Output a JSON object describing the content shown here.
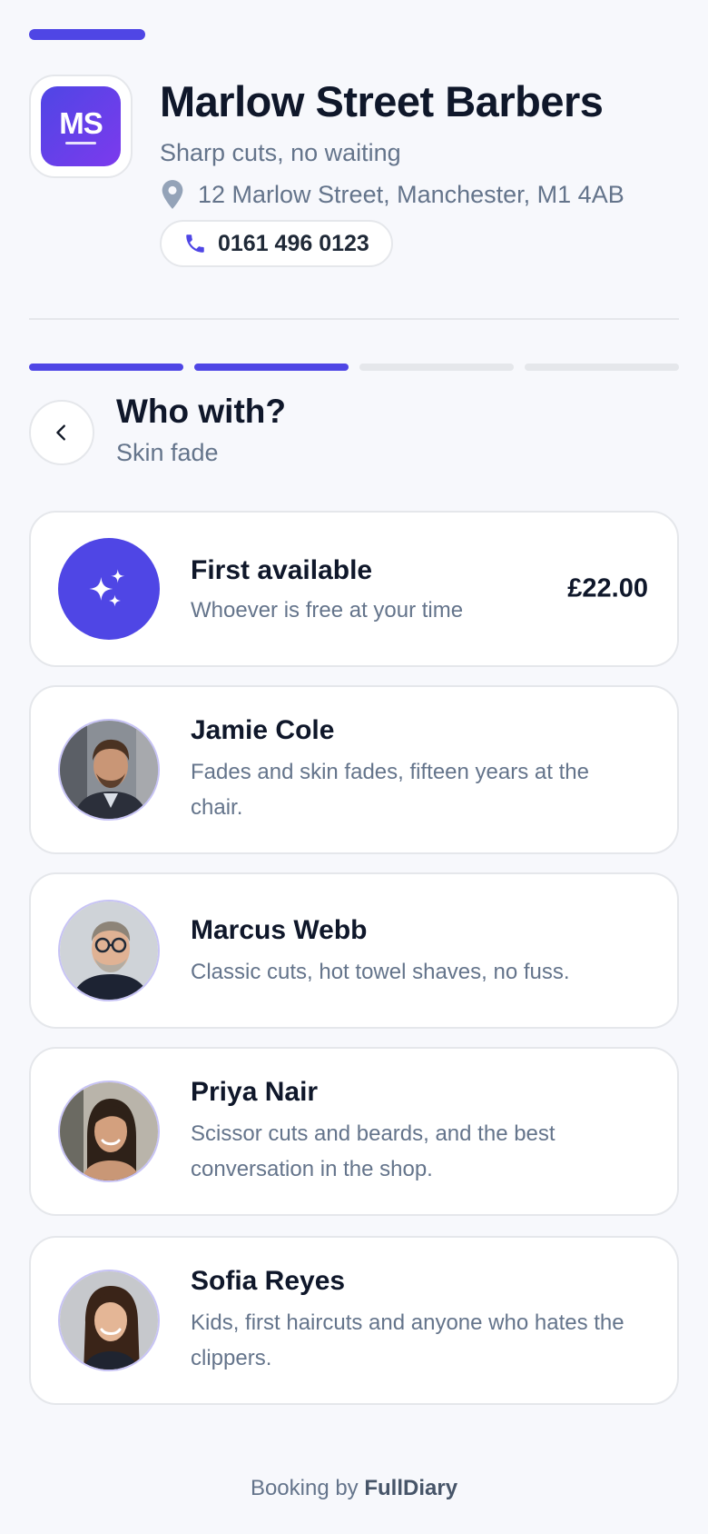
{
  "business": {
    "logo_initials": "MS",
    "name": "Marlow Street Barbers",
    "tagline": "Sharp cuts, no waiting",
    "address": "12 Marlow Street, Manchester, M1 4AB",
    "phone": "0161 496 0123"
  },
  "stepper": {
    "total_steps": 4,
    "completed_steps": 2
  },
  "step": {
    "title": "Who with?",
    "subtitle": "Skin fade"
  },
  "options": {
    "first_available": {
      "name": "First available",
      "description": "Whoever is free at your time",
      "price": "£22.00",
      "icon": "sparkles-icon"
    },
    "staff": [
      {
        "name": "Jamie Cole",
        "description": "Fades and skin fades, fifteen years at the chair."
      },
      {
        "name": "Marcus Webb",
        "description": "Classic cuts, hot towel shaves, no fuss."
      },
      {
        "name": "Priya Nair",
        "description": "Scissor cuts and beards, and the best conversation in the shop."
      },
      {
        "name": "Sofia Reyes",
        "description": "Kids, first haircuts and anyone who hates the clippers."
      }
    ]
  },
  "footer": {
    "prefix": "Booking by",
    "brand": "FullDiary"
  },
  "colors": {
    "accent": "#4f46e5",
    "muted_text": "#64748b",
    "border": "#e5e7eb"
  }
}
